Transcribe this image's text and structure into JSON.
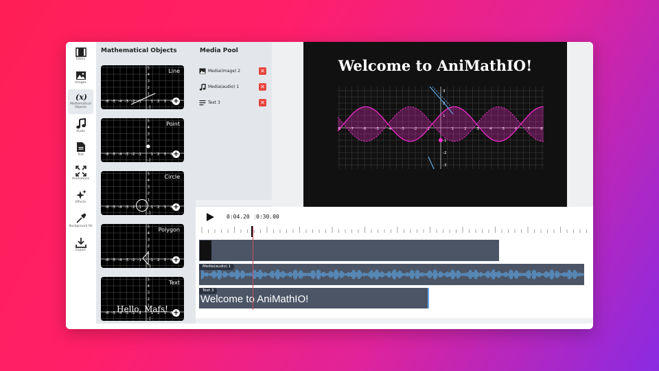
{
  "rail": [
    {
      "name": "filters",
      "label": "Filters",
      "icon": "film-icon"
    },
    {
      "name": "images",
      "label": "Images",
      "icon": "image-icon"
    },
    {
      "name": "math",
      "label": "Mathematical Objects",
      "icon": "function-icon"
    },
    {
      "name": "audio",
      "label": "Audio",
      "icon": "music-note-icon"
    },
    {
      "name": "text",
      "label": "Text",
      "icon": "document-icon"
    },
    {
      "name": "animations",
      "label": "Animations",
      "icon": "expand-arrows-icon"
    },
    {
      "name": "effects",
      "label": "Effects",
      "icon": "sparkles-icon"
    },
    {
      "name": "background",
      "label": "Background Fill",
      "icon": "eyedropper-icon"
    },
    {
      "name": "export",
      "label": "Export",
      "icon": "download-icon"
    }
  ],
  "rail_icon_glyph": "(x)",
  "objects": {
    "title": "Mathematical Objects",
    "cards": [
      {
        "title": "Line"
      },
      {
        "title": "Point"
      },
      {
        "title": "Circle"
      },
      {
        "title": "Polygon"
      },
      {
        "title": "Text",
        "sample": "Hello, Mafs!"
      }
    ],
    "x_ticks": [
      "-6",
      "-5",
      "-4",
      "-3",
      "-2",
      "-1",
      "1",
      "2",
      "3",
      "4",
      "5"
    ],
    "y_ticks": [
      "5",
      "4",
      "3",
      "2",
      "1",
      "-1"
    ]
  },
  "media_pool": {
    "title": "Media Pool",
    "items": [
      {
        "label": "Media(image) 2",
        "icon": "image-icon"
      },
      {
        "label": "Media(audio) 1",
        "icon": "music-note-icon"
      },
      {
        "label": "Text 3",
        "icon": "text-lines-icon"
      }
    ],
    "delete_glyph": "✕"
  },
  "preview": {
    "title": "Welcome to AniMathIO!",
    "x_ticks": [
      "-8",
      "-7",
      "-6",
      "-5",
      "-4",
      "-3",
      "-2",
      "-1",
      "1",
      "2",
      "3",
      "4",
      "5",
      "6",
      "7",
      "8"
    ],
    "y_ticks": [
      "3",
      "2",
      "1",
      "-1",
      "-2",
      "-3"
    ]
  },
  "timeline": {
    "current_time": "0:04.20",
    "total_time": "0:30.00",
    "tracks": [
      {
        "label": ""
      },
      {
        "label": "Media(audio) 1"
      },
      {
        "label": "Text 3",
        "text": "Welcome to AniMathIO!"
      }
    ]
  },
  "colors": {
    "accent_pink": "#ff2bd6",
    "accent_blue": "#5fa8e8",
    "delete_red": "#e9453f",
    "track_gray": "#4b5566"
  }
}
